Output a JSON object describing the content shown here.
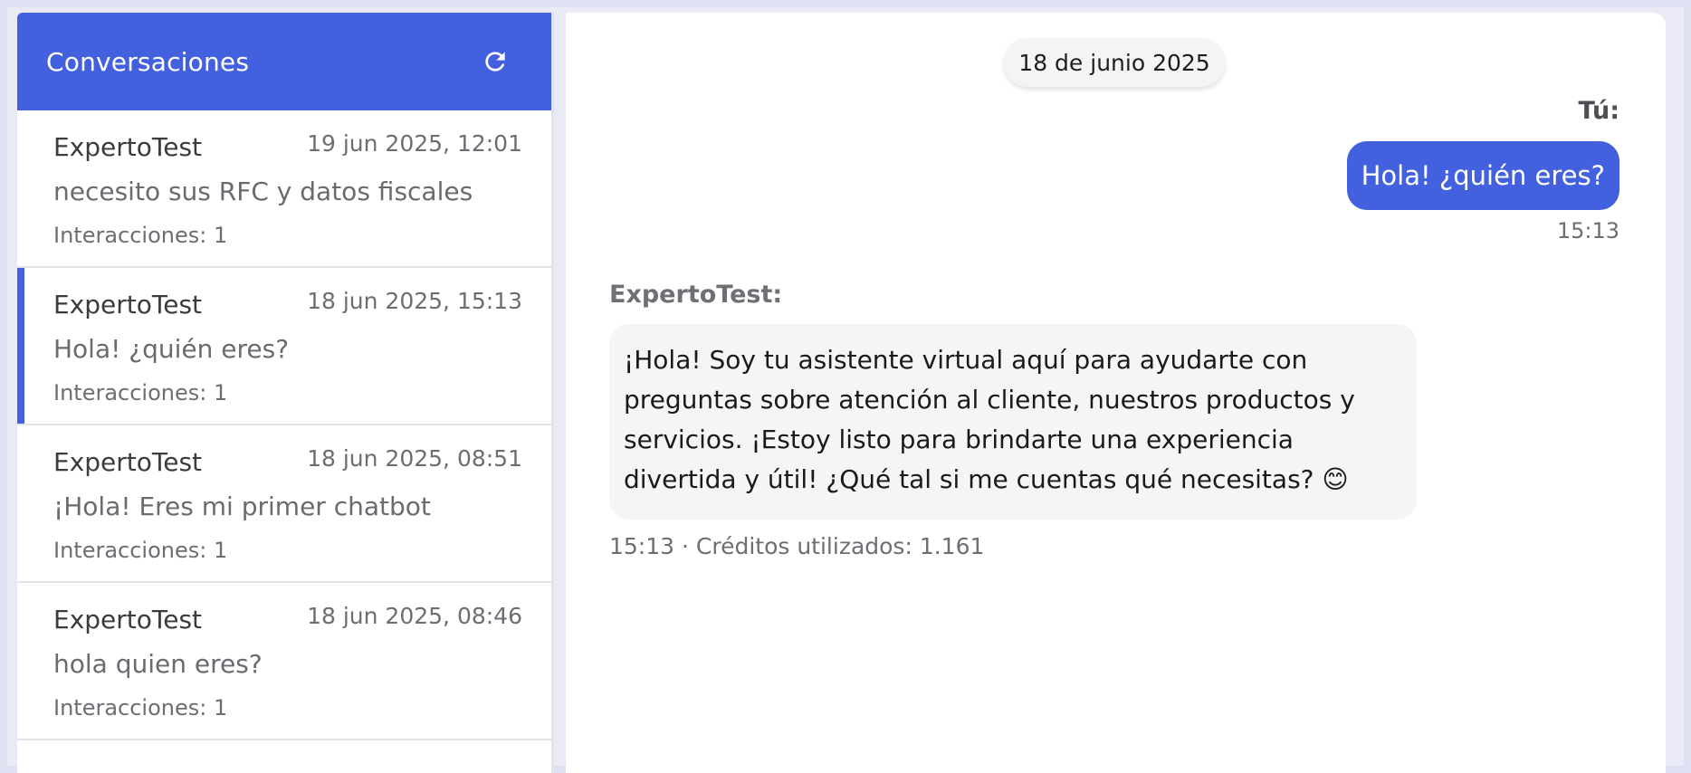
{
  "sidebar": {
    "title": "Conversaciones",
    "refresh_icon": "refresh-icon",
    "items": [
      {
        "name": "ExpertoTest",
        "date": "19 jun 2025, 12:01",
        "preview": "necesito sus RFC y datos fiscales",
        "count": "Interacciones: 1",
        "active": false
      },
      {
        "name": "ExpertoTest",
        "date": "18 jun 2025, 15:13",
        "preview": "Hola! ¿quién eres?",
        "count": "Interacciones: 1",
        "active": true
      },
      {
        "name": "ExpertoTest",
        "date": "18 jun 2025, 08:51",
        "preview": "¡Hola! Eres mi primer chatbot",
        "count": "Interacciones: 1",
        "active": false
      },
      {
        "name": "ExpertoTest",
        "date": "18 jun 2025, 08:46",
        "preview": "hola quien eres?",
        "count": "Interacciones: 1",
        "active": false
      }
    ]
  },
  "chat": {
    "date_separator": "18 de junio 2025",
    "user_label": "Tú:",
    "user_message": "Hola! ¿quién eres?",
    "user_time": "15:13",
    "bot_label": "ExpertoTest:",
    "bot_message": "¡Hola! Soy tu asistente virtual aquí para ayudarte con preguntas sobre atención al cliente, nuestros productos y servicios. ¡Estoy listo para brindarte una experiencia divertida y útil! ¿Qué tal si me cuentas qué necesitas? 😊",
    "bot_meta": "15:13 · Créditos utilizados: 1.161"
  },
  "colors": {
    "accent": "#4361df",
    "background": "#dfe1f3",
    "bubble_bot": "#f5f5f5"
  }
}
